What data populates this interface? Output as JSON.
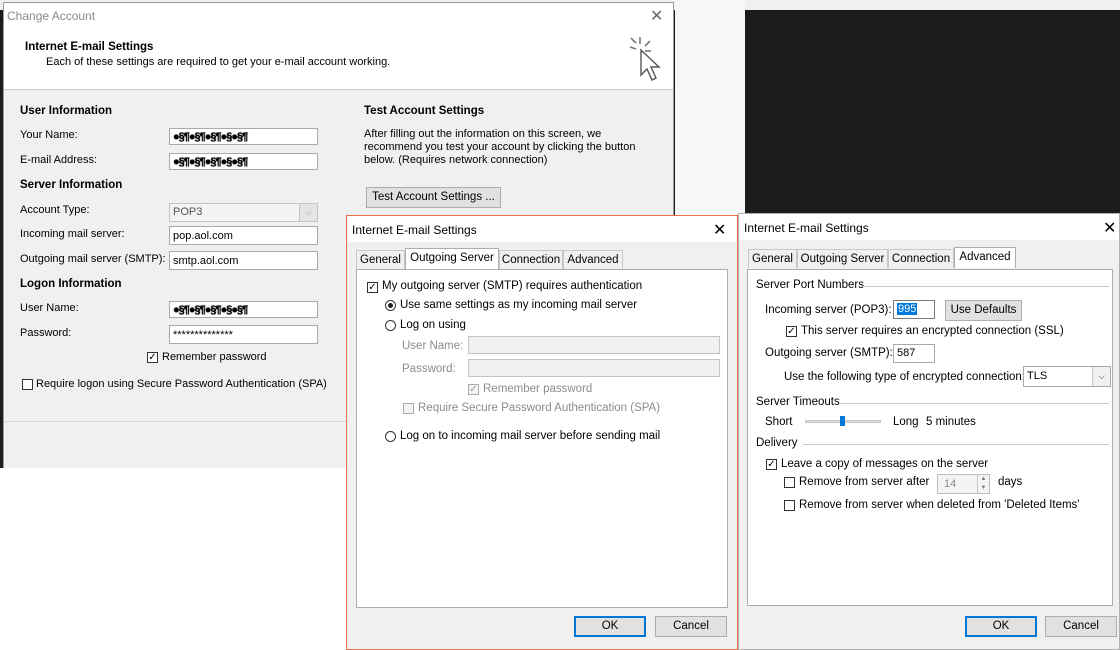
{
  "change_account": {
    "window_title": "Change Account",
    "header_title": "Internet E-mail Settings",
    "header_subtitle": "Each of these settings are required to get your e-mail account working.",
    "user_info": {
      "title": "User Information",
      "your_name_label": "Your Name:",
      "your_name_value": "●§¶●§¶●§¶●§●§¶",
      "email_label": "E-mail Address:",
      "email_value": "●§¶●§¶●§¶●§●§¶"
    },
    "server_info": {
      "title": "Server Information",
      "account_type_label": "Account Type:",
      "account_type_value": "POP3",
      "incoming_label": "Incoming mail server:",
      "incoming_value": "pop.aol.com",
      "outgoing_label": "Outgoing mail server (SMTP):",
      "outgoing_value": "smtp.aol.com"
    },
    "logon_info": {
      "title": "Logon Information",
      "user_name_label": "User Name:",
      "user_name_value": "●§¶●§¶●§¶●§●§¶",
      "password_label": "Password:",
      "password_value": "**************",
      "remember_password": "Remember password",
      "require_spa": "Require logon using Secure Password Authentication (SPA)"
    },
    "test_settings": {
      "title": "Test Account Settings",
      "description": "After filling out the information on this screen, we recommend you test your account by clicking the button below. (Requires network connection)",
      "button": "Test Account Settings ..."
    }
  },
  "outgoing_dialog": {
    "title": "Internet E-mail Settings",
    "tabs": [
      "General",
      "Outgoing Server",
      "Connection",
      "Advanced"
    ],
    "smtp_auth": "My outgoing server (SMTP) requires authentication",
    "use_same": "Use same settings as my incoming mail server",
    "log_on_using": "Log on using",
    "user_name_label": "User Name:",
    "password_label": "Password:",
    "remember_password": "Remember password",
    "require_spa": "Require Secure Password Authentication (SPA)",
    "log_on_incoming": "Log on to incoming mail server before sending mail",
    "ok": "OK",
    "cancel": "Cancel"
  },
  "advanced_dialog": {
    "title": "Internet E-mail Settings",
    "tabs": [
      "General",
      "Outgoing Server",
      "Connection",
      "Advanced"
    ],
    "server_ports_title": "Server Port Numbers",
    "incoming_label": "Incoming server (POP3):",
    "incoming_port": "995",
    "use_defaults": "Use Defaults",
    "ssl_label": "This server requires an encrypted connection (SSL)",
    "outgoing_label": "Outgoing server (SMTP):",
    "outgoing_port": "587",
    "encryption_label": "Use the following type of encrypted connection:",
    "encryption_value": "TLS",
    "timeouts_title": "Server Timeouts",
    "short_label": "Short",
    "long_label": "Long",
    "timeout_value": "5 minutes",
    "delivery_title": "Delivery",
    "leave_copy": "Leave a copy of messages on the server",
    "remove_after": "Remove from server after",
    "remove_days_value": "14",
    "days_label": "days",
    "remove_deleted": "Remove from server when deleted from 'Deleted Items'",
    "ok": "OK",
    "cancel": "Cancel"
  }
}
